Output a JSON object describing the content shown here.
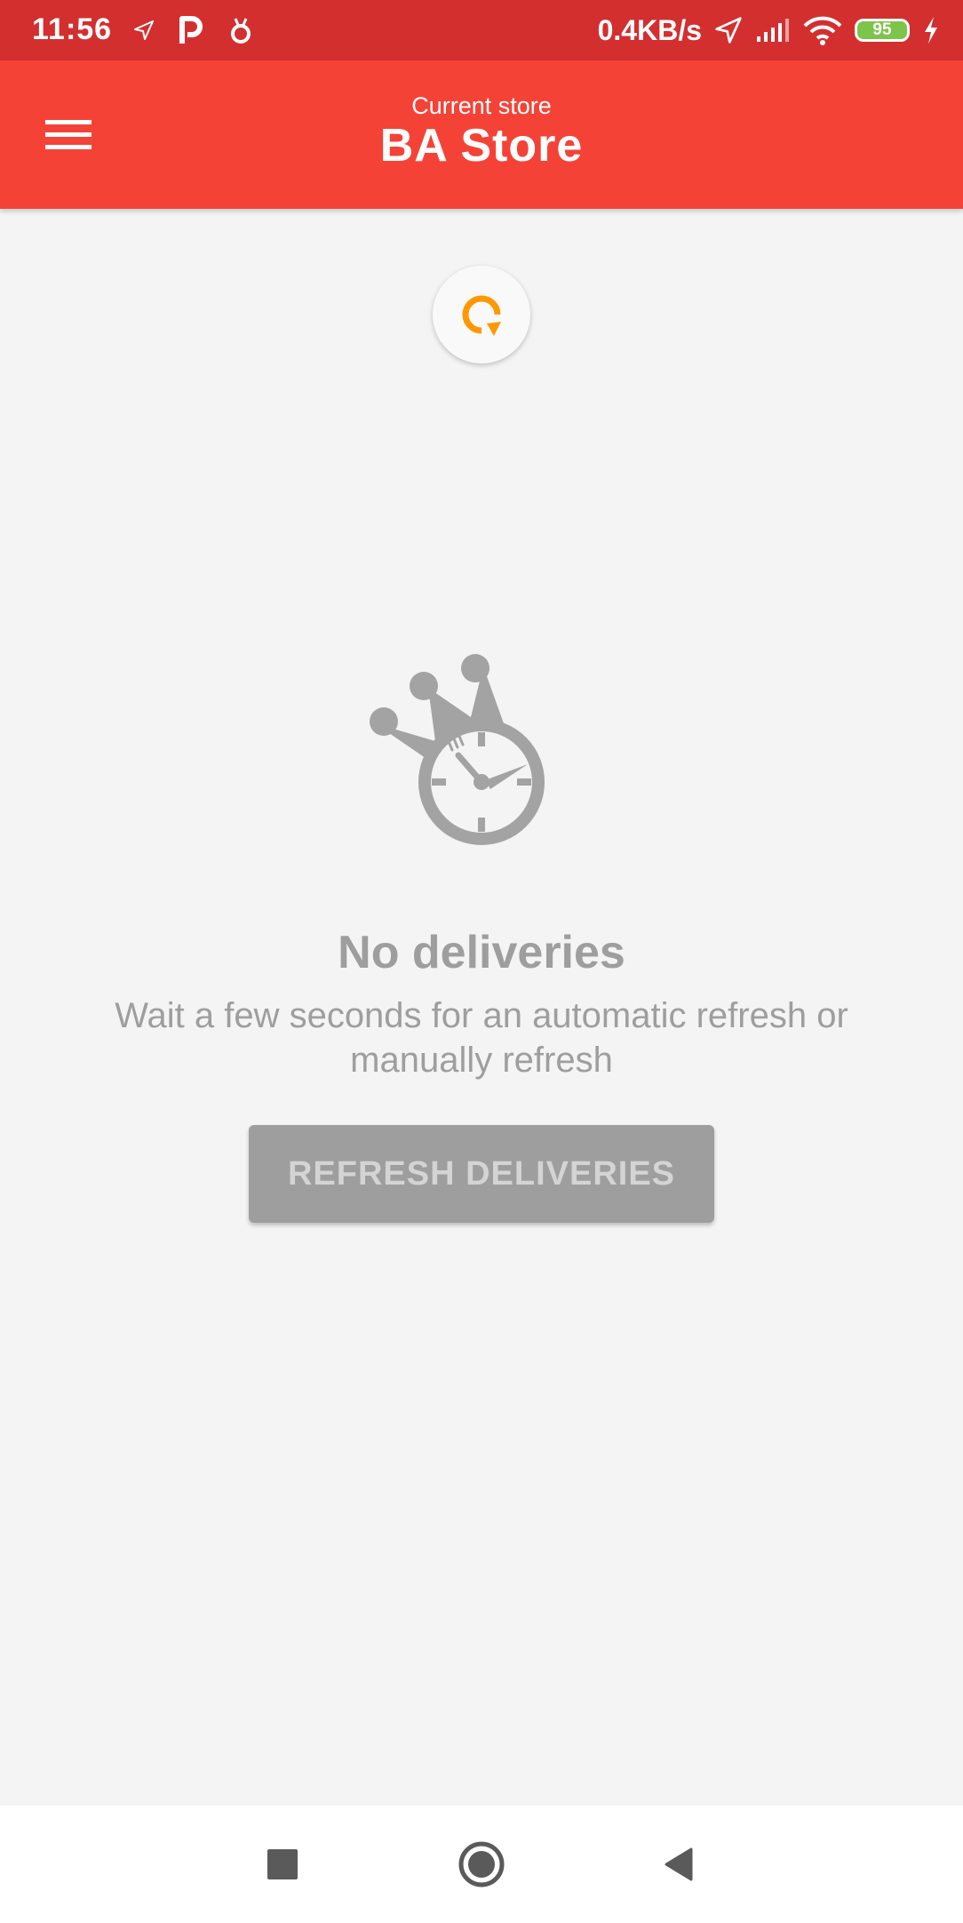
{
  "status_bar": {
    "time": "11:56",
    "network_speed": "0.4KB/s",
    "battery_level": "95",
    "icons": [
      "location-arrow-icon",
      "parking-icon",
      "bug-icon",
      "location-arrow-icon",
      "signal-icon",
      "wifi-icon",
      "battery-icon",
      "charging-icon"
    ]
  },
  "app_bar": {
    "menu_icon": "hamburger-menu-icon",
    "subtitle": "Current store",
    "title": "BA Store",
    "color": "#f44336"
  },
  "refresh_indicator": {
    "icon": "refresh-icon",
    "color": "#ff9800"
  },
  "empty_state": {
    "icon": "crown-clock-icon",
    "title": "No deliveries",
    "message": "Wait a few seconds for an automatic refresh or manually refresh",
    "button_label": "REFRESH DELIVERIES"
  },
  "nav_bar": {
    "items": [
      "recents-square-icon",
      "home-circle-icon",
      "back-triangle-icon"
    ]
  }
}
